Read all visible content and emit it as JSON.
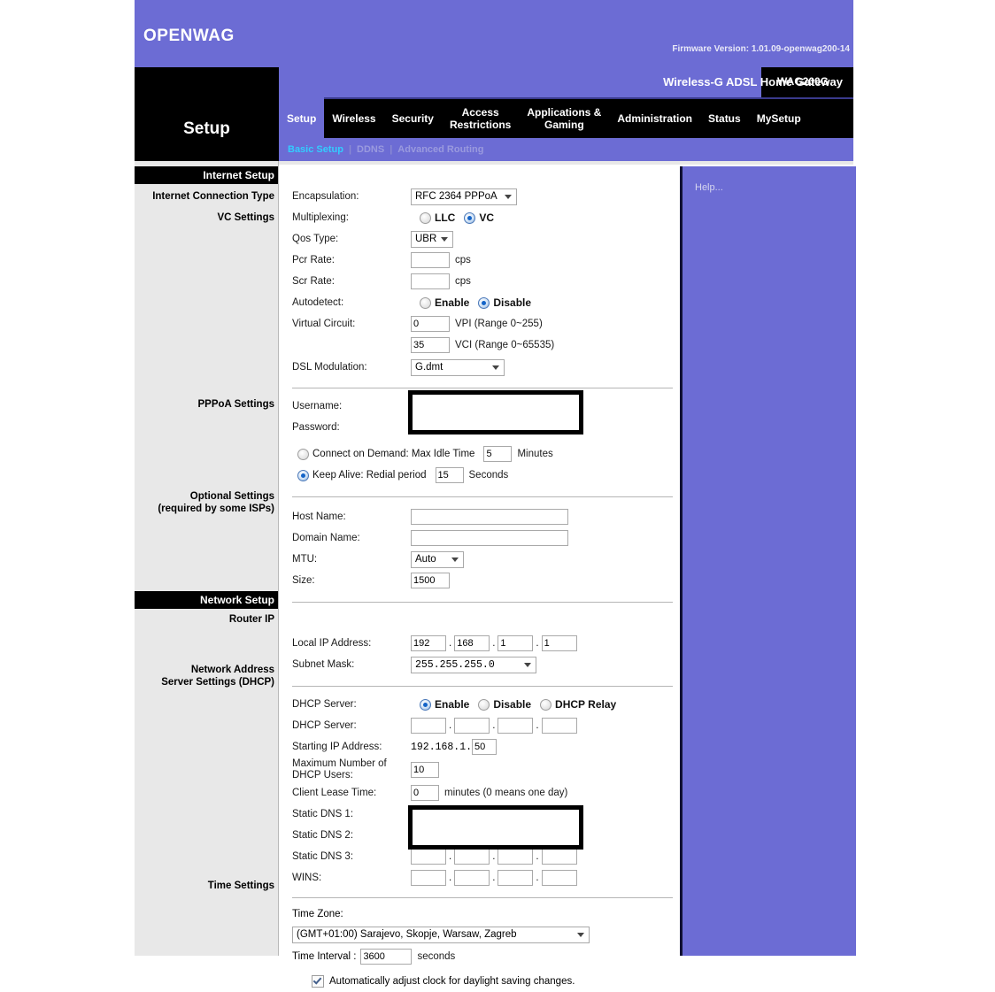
{
  "header": {
    "logo": "OpenWAG",
    "firmware": "Firmware Version: 1.01.09-openwag200-14"
  },
  "titlebar": {
    "product": "Wireless-G ADSL Home Gateway",
    "model": "WAG200G"
  },
  "section_title": "Setup",
  "tabs": [
    {
      "label": "Setup",
      "active": true
    },
    {
      "label": "Wireless",
      "active": false
    },
    {
      "label": "Security",
      "active": false
    },
    {
      "label": "Access\nRestrictions",
      "active": false
    },
    {
      "label": "Applications &\nGaming",
      "active": false
    },
    {
      "label": "Administration",
      "active": false
    },
    {
      "label": "Status",
      "active": false
    },
    {
      "label": "MySetup",
      "active": false
    }
  ],
  "subnav": [
    {
      "label": "Basic Setup",
      "active": true
    },
    {
      "label": "DDNS",
      "active": false
    },
    {
      "label": "Advanced Routing",
      "active": false
    }
  ],
  "subnav_sep": "|",
  "sidebar": {
    "internet_setup": "Internet Setup",
    "internet_connection_type": "Internet Connection Type",
    "vc_settings": "VC Settings",
    "pppoa_settings": "PPPoA Settings",
    "optional_settings": "Optional Settings\n(required by some ISPs)",
    "network_setup": "Network Setup",
    "router_ip": "Router IP",
    "network_address": "Network Address\nServer Settings (DHCP)",
    "time_settings": "Time Settings"
  },
  "internet": {
    "encapsulation_label": "Encapsulation:",
    "encapsulation_value": "RFC 2364 PPPoA",
    "multiplexing_label": "Multiplexing:",
    "multiplexing_llc": "LLC",
    "multiplexing_vc": "VC",
    "qos_label": "Qos Type:",
    "qos_value": "UBR",
    "pcr_label": "Pcr Rate:",
    "pcr_value": "",
    "pcr_unit": "cps",
    "scr_label": "Scr Rate:",
    "scr_value": "",
    "scr_unit": "cps",
    "autodetect_label": "Autodetect:",
    "autodetect_enable": "Enable",
    "autodetect_disable": "Disable",
    "vc_label": "Virtual Circuit:",
    "vpi_value": "0",
    "vpi_hint": "VPI (Range 0~255)",
    "vci_value": "35",
    "vci_hint": "VCI (Range 0~65535)",
    "dsl_label": "DSL Modulation:",
    "dsl_value": "G.dmt"
  },
  "pppoa": {
    "username_label": "Username:",
    "username_value": "",
    "password_label": "Password:",
    "password_value": "",
    "connect_on_demand": "Connect on Demand: Max Idle Time",
    "max_idle_value": "5",
    "minutes": "Minutes",
    "keep_alive": "Keep Alive: Redial period",
    "redial_value": "15",
    "seconds": "Seconds"
  },
  "optional": {
    "host_label": "Host Name:",
    "host_value": "",
    "domain_label": "Domain Name:",
    "domain_value": "",
    "mtu_label": "MTU:",
    "mtu_value": "Auto",
    "size_label": "Size:",
    "size_value": "1500"
  },
  "routerip": {
    "local_ip_label": "Local IP Address:",
    "local_ip": [
      "192",
      "168",
      "1",
      "1"
    ],
    "subnet_label": "Subnet Mask:",
    "subnet_value": "255.255.255.0"
  },
  "dhcp": {
    "server_label": "DHCP Server:",
    "enable": "Enable",
    "disable": "Disable",
    "relay": "DHCP Relay",
    "relay_ip": [
      "",
      "",
      "",
      ""
    ],
    "starting_label": "Starting IP Address:",
    "starting_prefix": "192.168.1.",
    "starting_value": "50",
    "max_users_label": "Maximum Number of\nDHCP Users:",
    "max_users_value": "10",
    "lease_label": "Client Lease Time:",
    "lease_value": "0",
    "lease_hint": "minutes (0 means one day)",
    "dns1_label": "Static DNS 1:",
    "dns1": [
      "",
      "",
      "",
      ""
    ],
    "dns2_label": "Static DNS 2:",
    "dns2": [
      "",
      "",
      "",
      ""
    ],
    "dns3_label": "Static DNS 3:",
    "dns3": [
      "",
      "",
      "",
      ""
    ],
    "wins_label": "WINS:",
    "wins": [
      "",
      "",
      "",
      ""
    ]
  },
  "time": {
    "zone_label": "Time Zone:",
    "zone_value": "(GMT+01:00) Sarajevo, Skopje, Warsaw, Zagreb",
    "interval_label": "Time Interval :",
    "interval_value": "3600",
    "interval_unit": "seconds",
    "dst_label": "Automatically adjust clock for daylight saving changes."
  },
  "help": {
    "text": "Help..."
  },
  "colors": {
    "brand_purple": "#6c6cd4",
    "black": "#000000",
    "link_cyan": "#33ccff",
    "sidebar_grey": "#e8e8e8"
  }
}
